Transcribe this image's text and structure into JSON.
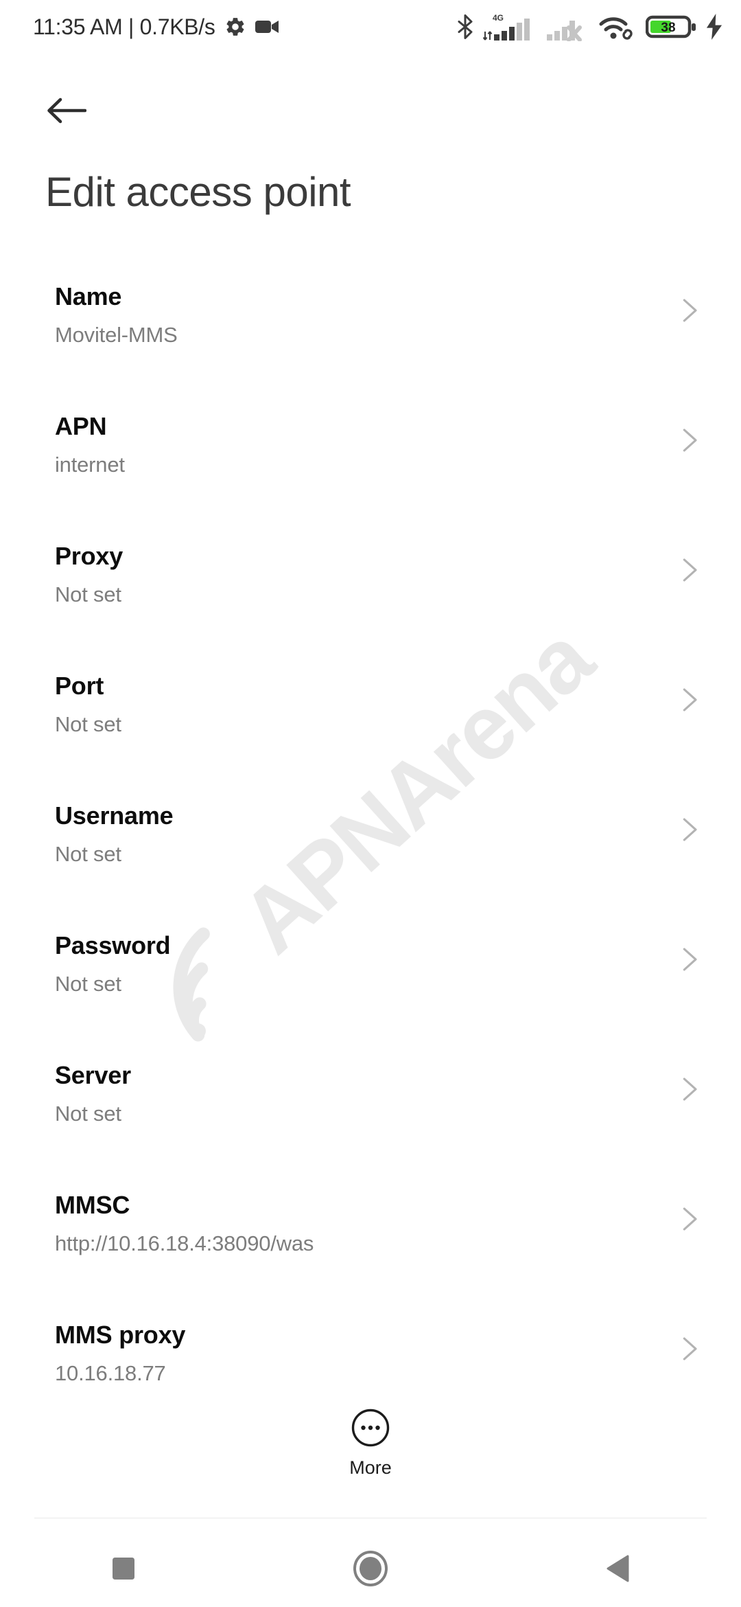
{
  "status_bar": {
    "clock": "11:35 AM | 0.7KB/s",
    "left_icons": [
      "gear-icon",
      "video-camera-icon"
    ],
    "right_icons": [
      "bluetooth-icon",
      "signal-4g-icon",
      "signal-sim2-no-service-icon",
      "wifi-link-icon",
      "battery-icon",
      "charging-bolt-icon"
    ],
    "network_type": "4G",
    "battery_level": "38",
    "battery_color": "#44d62c"
  },
  "header": {
    "back_icon": "arrow-left-icon",
    "title": "Edit access point"
  },
  "watermark": {
    "text": "APNArena",
    "color": "#e9e9e9"
  },
  "list": {
    "rows": [
      {
        "label": "Name",
        "value": "Movitel-MMS"
      },
      {
        "label": "APN",
        "value": "internet"
      },
      {
        "label": "Proxy",
        "value": "Not set"
      },
      {
        "label": "Port",
        "value": "Not set"
      },
      {
        "label": "Username",
        "value": "Not set"
      },
      {
        "label": "Password",
        "value": "Not set"
      },
      {
        "label": "Server",
        "value": "Not set"
      },
      {
        "label": "MMSC",
        "value": "http://10.16.18.4:38090/was"
      },
      {
        "label": "MMS proxy",
        "value": "10.16.18.77"
      }
    ]
  },
  "more": {
    "label": "More",
    "icon": "more-horizontal-circle-icon"
  },
  "nav_bar": {
    "recents_icon": "square-icon",
    "home_icon": "circle-icon",
    "back_icon": "triangle-left-icon",
    "color": "#808080"
  }
}
